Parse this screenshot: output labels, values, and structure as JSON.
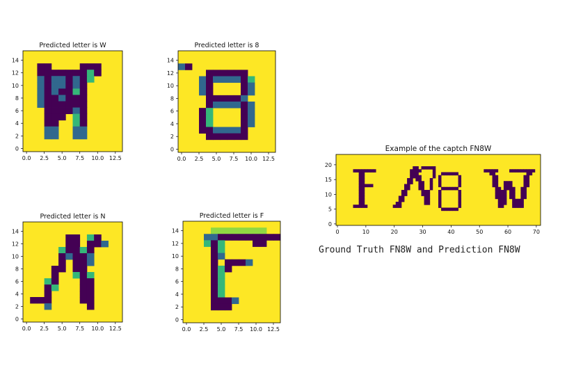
{
  "colors": {
    "background": "#fde725",
    "foreground": "#440154",
    "mid": "#31688e",
    "light": "#35b779",
    "pale": "#90d743"
  },
  "chart_data": [
    {
      "type": "heatmap",
      "title": "Predicted letter is W",
      "xticks": [
        "0.0",
        "2.5",
        "5.0",
        "7.5",
        "10.0",
        "12.5"
      ],
      "yticks": [
        "0",
        "2",
        "4",
        "6",
        "8",
        "10",
        "12",
        "14"
      ],
      "xlim": [
        -0.5,
        13.5
      ],
      "ylim": [
        15.5,
        -0.5
      ],
      "rows": [
        "..............",
        "..............",
        "..##....###...",
        "..#######l#...",
        "..m#mm#m#l....",
        "..m#mm#m#.....",
        "..m#m##l#.....",
        "..m##m###.....",
        "..m######.....",
        "...####m#.....",
        "...###.l#.....",
        "...##..l#.....",
        "...mm..mm.....",
        "...mm..mm.....",
        "..............",
        ".............."
      ]
    },
    {
      "type": "heatmap",
      "title": "Predicted letter is 8",
      "xticks": [
        "0.0",
        "2.5",
        "5.0",
        "7.5",
        "10.0",
        "12.5"
      ],
      "yticks": [
        "0",
        "2",
        "4",
        "6",
        "8",
        "10",
        "12",
        "14"
      ],
      "xlim": [
        -0.5,
        13.5
      ],
      "ylim": [
        15.5,
        -0.5
      ],
      "rows": [
        "..............",
        "..............",
        "m#............",
        "....######....",
        "...m#mmmm#l...",
        "...m#....#m...",
        "...m#....#m...",
        "....#####m....",
        "....#mmmm#m...",
        "...#l....#m...",
        "...#l....#m...",
        "...#l....#m...",
        "...##mmmm#....",
        "....######....",
        "..............",
        ".............."
      ]
    },
    {
      "type": "heatmap",
      "title": "Predicted letter is N",
      "xticks": [
        "0.0",
        "2.5",
        "5.0",
        "7.5",
        "10.0",
        "12.5"
      ],
      "yticks": [
        "0",
        "2",
        "4",
        "6",
        "8",
        "10",
        "12",
        "14"
      ],
      "xlim": [
        -0.5,
        13.5
      ],
      "ylim": [
        15.5,
        -0.5
      ],
      "rows": [
        "..............",
        "..............",
        "......##.l#...",
        "......##.##m..",
        ".....l##l#....",
        ".....#m##m....",
        ".....#.##m....",
        "....##.##.....",
        "....#..l#l....",
        "...l#...##....",
        "...#l...##....",
        "...#....##....",
        ".###....##....",
        "...m.....#....",
        "..............",
        ".............."
      ]
    },
    {
      "type": "heatmap",
      "title": "Predicted letter is F",
      "xticks": [
        "0.0",
        "2.5",
        "5.0",
        "7.5",
        "10.0",
        "12.5"
      ],
      "yticks": [
        "0",
        "2",
        "4",
        "6",
        "8",
        "10",
        "12",
        "14"
      ],
      "xlim": [
        -0.5,
        13.5
      ],
      "ylim": [
        15.5,
        -0.5
      ],
      "rows": [
        "..............",
        "....pppppppp..",
        "...mm#########",
        "...l#l....##..",
        "....#l........",
        "....#m........",
        "....#.###m....",
        "....#l#.......",
        "....#l........",
        "....#l........",
        "....#l........",
        "....#l........",
        "....###m......",
        "....###.......",
        "..............",
        ".............."
      ]
    },
    {
      "type": "heatmap",
      "title": "Example of the captch FN8W",
      "xticks": [
        "0",
        "10",
        "20",
        "30",
        "40",
        "50",
        "60",
        "70"
      ],
      "yticks": [
        "0",
        "5",
        "10",
        "15",
        "20"
      ],
      "xlim": [
        -0.5,
        71.5
      ],
      "ylim": [
        23.5,
        -0.5
      ]
    }
  ],
  "caption": "Ground Truth FN8W and Prediction FN8W"
}
